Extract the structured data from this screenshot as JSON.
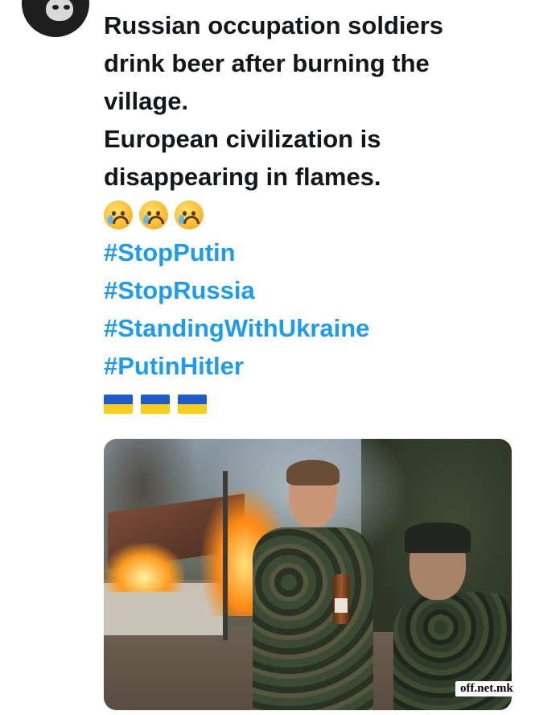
{
  "post": {
    "text_lines": [
      "Russian occupation soldiers",
      "drink beer after burning the",
      "village.",
      "European civilization is",
      "disappearing in flames."
    ],
    "emojis": [
      "crying-face-emoji",
      "crying-face-emoji",
      "crying-face-emoji"
    ],
    "hashtags": [
      "#StopPutin",
      "#StopRussia",
      "#StandingWithUkraine",
      "#PutinHitler"
    ],
    "flags": [
      "ukraine-flag-emoji",
      "ukraine-flag-emoji",
      "ukraine-flag-emoji"
    ]
  },
  "colors": {
    "text": "#14171a",
    "hashtag": "#1d9bf0",
    "background": "#ffffff"
  },
  "watermark": "off.net.mk"
}
